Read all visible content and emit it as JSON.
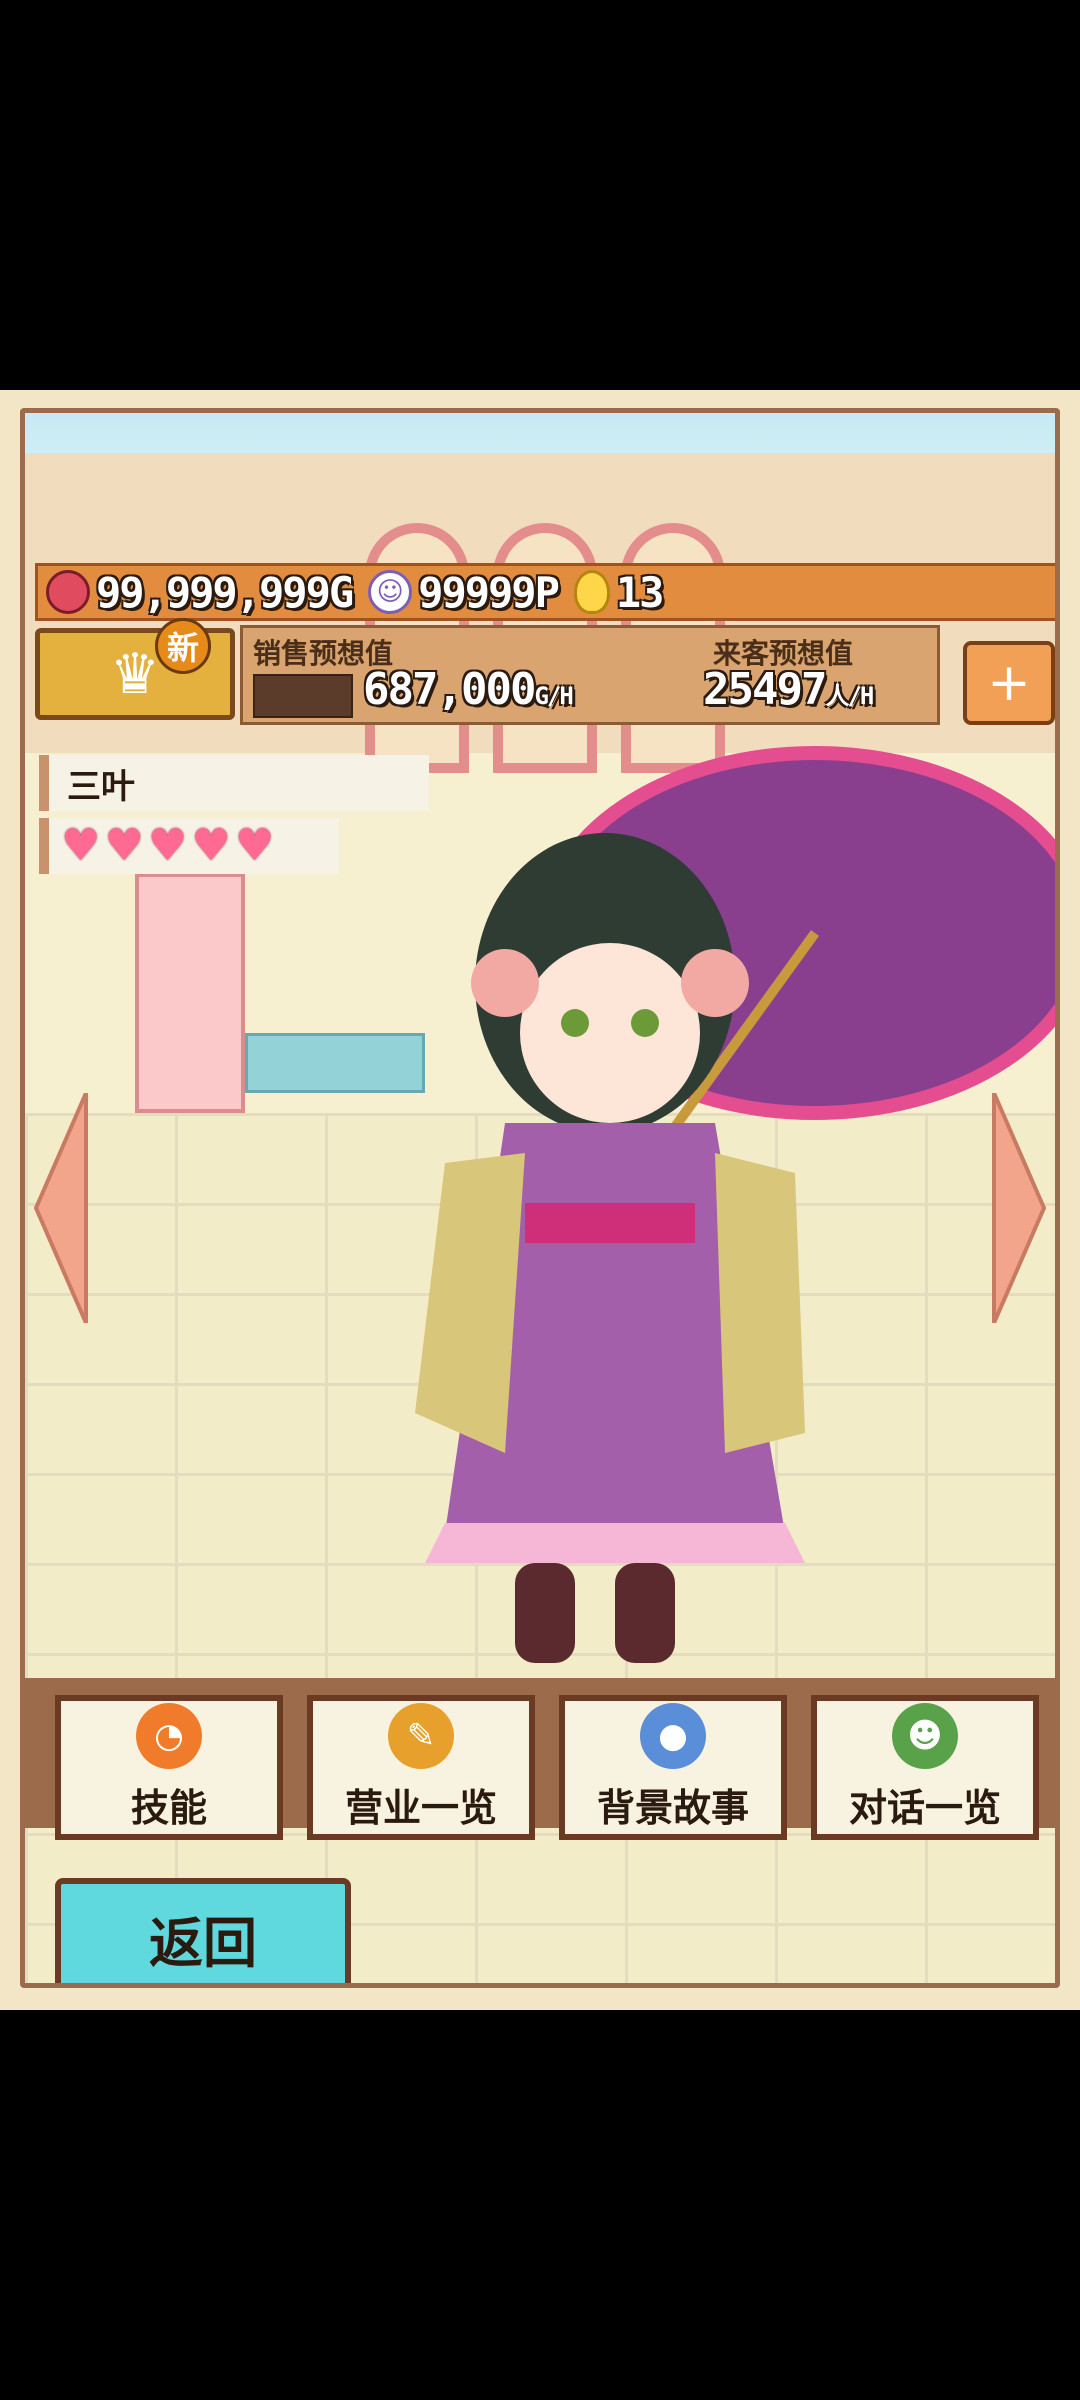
{
  "stats": {
    "gold": "99,999,999G",
    "points": "99999P",
    "eggs": "13"
  },
  "forecast": {
    "sales_label": "销售预想值",
    "visitor_label": "来客预想值",
    "sales_value": "687,000",
    "sales_unit": "G/H",
    "visitor_value": "25497",
    "visitor_unit": "人/H"
  },
  "badge": {
    "new_label": "新"
  },
  "character": {
    "name": "三叶",
    "hearts": 5
  },
  "menu": {
    "items": [
      {
        "label": "技能",
        "icon": "megaphone-icon"
      },
      {
        "label": "营业一览",
        "icon": "broom-icon"
      },
      {
        "label": "背景故事",
        "icon": "footprints-icon"
      },
      {
        "label": "对话一览",
        "icon": "face-icon"
      }
    ],
    "back_label": "返回"
  },
  "colors": {
    "stats_bar": "#e18c3e",
    "back_button": "#5fd9dd",
    "heart": "#ff6a93"
  }
}
